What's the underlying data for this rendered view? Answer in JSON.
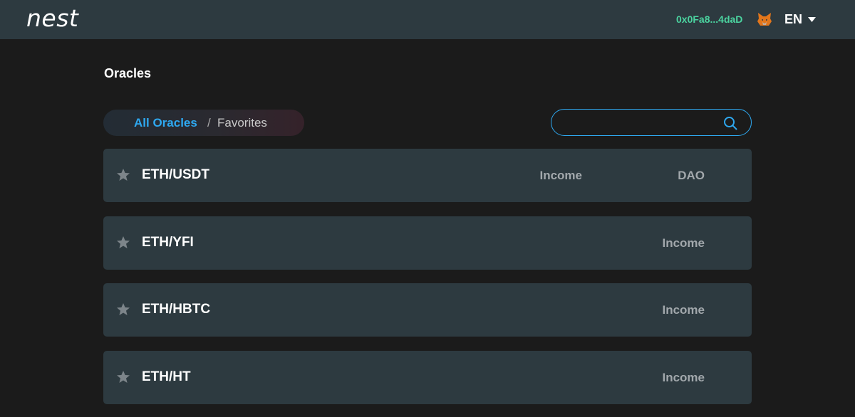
{
  "header": {
    "logo": "nest",
    "wallet_address": "0x0Fa8...4daD",
    "wallet_icon": "metamask-fox-icon",
    "language": "EN"
  },
  "page": {
    "title": "Oracles"
  },
  "tabs": {
    "all_label": "All Oracles",
    "separator": "/",
    "favorites_label": "Favorites"
  },
  "search": {
    "value": "",
    "placeholder": ""
  },
  "oracles": [
    {
      "pair": "ETH/USDT",
      "income": "Income",
      "dao": "DAO"
    },
    {
      "pair": "ETH/YFI",
      "income": "Income"
    },
    {
      "pair": "ETH/HBTC",
      "income": "Income"
    },
    {
      "pair": "ETH/HT",
      "income": "Income"
    }
  ],
  "colors": {
    "accent": "#2ea8f0",
    "wallet": "#4bd4a0",
    "header_bg": "#2d3a40",
    "page_bg": "#1b1b1b",
    "row_bg": "#2d3a40"
  }
}
